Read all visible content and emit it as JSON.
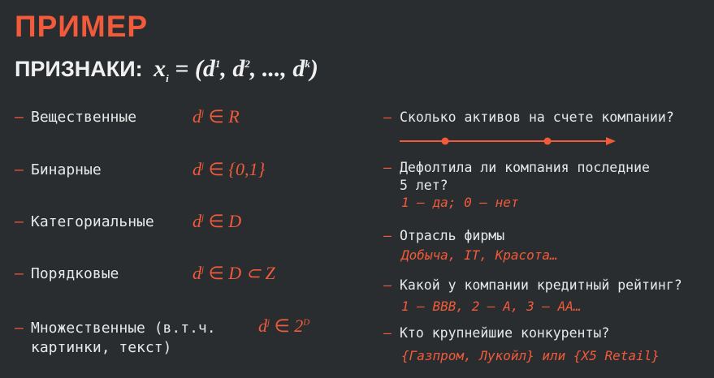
{
  "title": "ПРИМЕР",
  "subtitle": {
    "label": "ПРИЗНАКИ:",
    "formula_lhs": "x",
    "formula_sub": "i",
    "formula_eq": " = (d",
    "s1": "1",
    "c1": ", d",
    "s2": "2",
    "c2": ", ..., d",
    "s3": "k",
    "end": ")"
  },
  "left_items": [
    {
      "label": "Вещественные",
      "math_var": "d",
      "math_sup": "j",
      "math_op": " ∈ ",
      "math_set": "R"
    },
    {
      "label": "Бинарные",
      "math_var": "d",
      "math_sup": "j",
      "math_op": " ∈ ",
      "math_set": "{0,1}"
    },
    {
      "label": "Категориальные",
      "math_var": "d",
      "math_sup": "j",
      "math_op": " ∈ ",
      "math_set": "D"
    },
    {
      "label": "Порядковые",
      "math_var": "d",
      "math_sup": "j",
      "math_op": " ∈ ",
      "math_set": "D ⊂ Z"
    },
    {
      "label_line1": "Множественные (в.т.ч.",
      "label_line2": "картинки, текст)",
      "math_var": "d",
      "math_sup": "j",
      "math_op": " ∈ ",
      "math_set": "2",
      "math_set_sup": "D"
    }
  ],
  "dash": "—",
  "right_items": [
    {
      "question": "Сколько активов на счете компании?"
    },
    {
      "question_line1": "Дефолтила ли компания последние",
      "question_line2": "5 лет?",
      "answer": "1 – да; 0 – нет"
    },
    {
      "question": "Отрасль фирмы",
      "answer": "Добыча, IT, Красота…"
    },
    {
      "question": "Какой у компании кредитный рейтинг?",
      "answer": "1 – BBB, 2 – A, 3 – AA…"
    },
    {
      "question": "Кто крупнейшие конкуренты?",
      "answer": "{Газпром, Лукойл} или {X5 Retail}"
    }
  ],
  "colors": {
    "accent": "#f15a3a",
    "background": "#2a2d2f",
    "text": "#e8e8e8"
  }
}
